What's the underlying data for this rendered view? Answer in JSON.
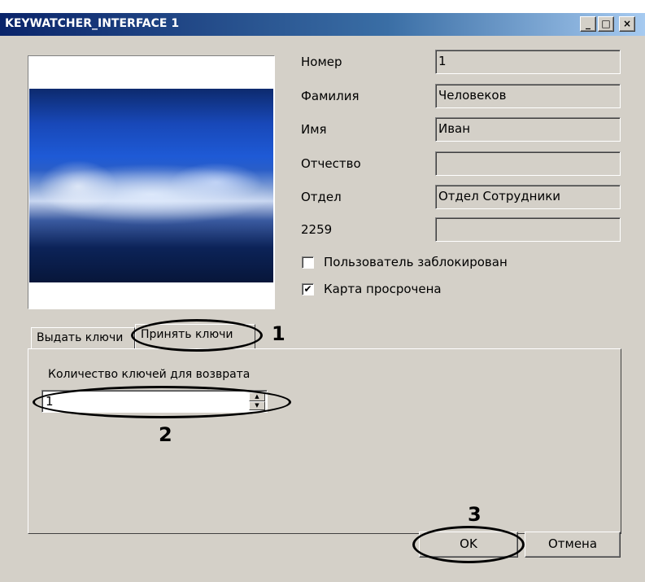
{
  "window": {
    "title": "KEYWATCHER_INTERFACE 1",
    "min_glyph": "_",
    "max_glyph": "□",
    "close_glyph": "×"
  },
  "photo": {
    "icon": "photo-placeholder"
  },
  "form": {
    "fields": [
      {
        "label": "Номер",
        "value": "1"
      },
      {
        "label": "Фамилия",
        "value": "Человеков"
      },
      {
        "label": "Имя",
        "value": "Иван"
      },
      {
        "label": "Отчество",
        "value": ""
      },
      {
        "label": "Отдел",
        "value": "Отдел Сотрудники"
      },
      {
        "label": "2259",
        "value": ""
      }
    ],
    "checkboxes": [
      {
        "label": "Пользователь заблокирован",
        "checked": false,
        "mark": ""
      },
      {
        "label": "Карта просрочена",
        "checked": true,
        "mark": "✔"
      }
    ]
  },
  "tabs": {
    "issue": "Выдать ключи",
    "receive": "Принять ключи"
  },
  "panel": {
    "count_label": "Количество ключей для возврата",
    "count_value": "1",
    "spin_up": "▲",
    "spin_down": "▼"
  },
  "buttons": {
    "ok": "OK",
    "cancel": "Отмена"
  },
  "annotations": {
    "n1": "1",
    "n2": "2",
    "n3": "3"
  }
}
